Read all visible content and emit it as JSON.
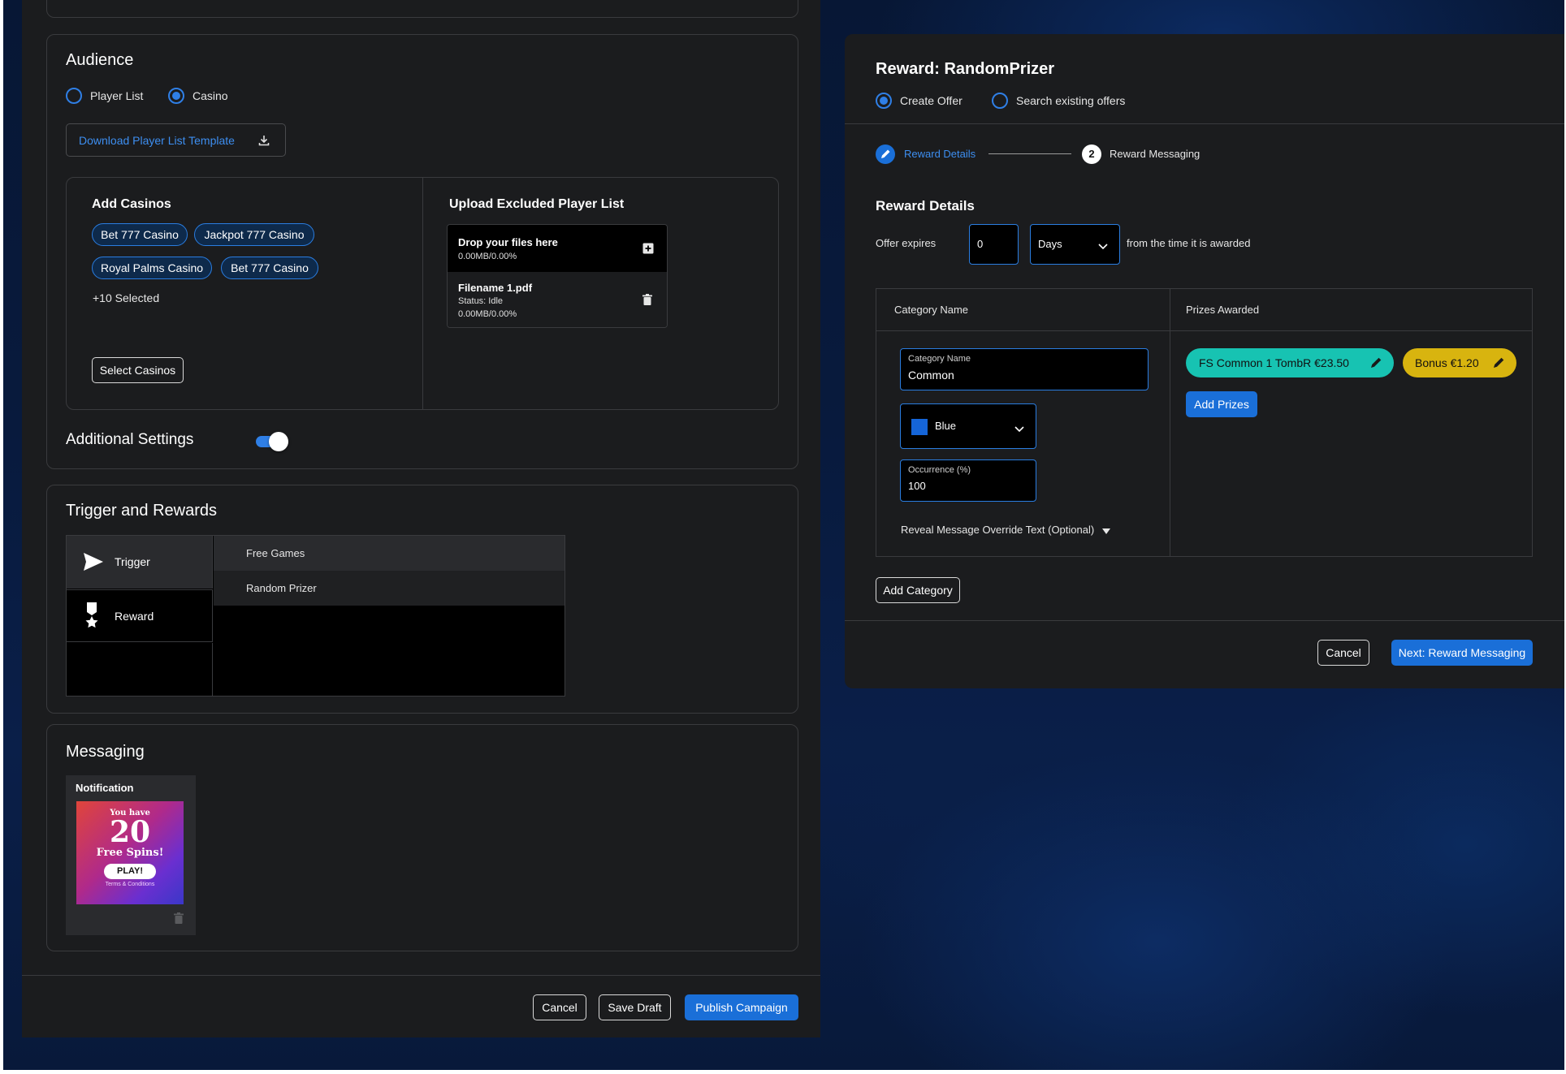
{
  "audience": {
    "title": "Audience",
    "radio_player_list": "Player List",
    "radio_casino": "Casino",
    "download_template": "Download Player List Template",
    "add_casinos_title": "Add Casinos",
    "casinos": [
      "Bet 777 Casino",
      "Jackpot 777 Casino",
      "Royal Palms Casino",
      "Bet 777 Casino"
    ],
    "more_selected": "+10 Selected",
    "select_casinos_button": "Select Casinos",
    "upload_title": "Upload Excluded Player List",
    "drop_title": "Drop your files here",
    "drop_progress": "0.00MB/0.00%",
    "file_name": "Filename 1.pdf",
    "file_status": "Status: Idle",
    "file_progress": "0.00MB/0.00%",
    "additional_settings": "Additional Settings",
    "additional_settings_enabled": true
  },
  "trigger_rewards": {
    "title": "Trigger and Rewards",
    "menu": [
      "Trigger",
      "Reward"
    ],
    "options": [
      "Free Games",
      "Random Prizer"
    ]
  },
  "messaging": {
    "title": "Messaging",
    "notification_label": "Notification",
    "promo_line1": "You have",
    "promo_number": "20",
    "promo_line2": "Free Spins!",
    "promo_button": "PLAY!",
    "promo_terms": "Terms & Conditions"
  },
  "footer": {
    "cancel": "Cancel",
    "save_draft": "Save Draft",
    "publish": "Publish Campaign"
  },
  "modal": {
    "title": "Reward: RandomPrizer",
    "radio_create": "Create Offer",
    "radio_search": "Search existing offers",
    "step1": "Reward Details",
    "step2_number": "2",
    "step2": "Reward Messaging",
    "section_title": "Reward Details",
    "offer_expires_label": "Offer expires",
    "offer_expires_value": "0",
    "offer_expires_unit": "Days",
    "offer_expires_suffix": "from the time it is awarded",
    "table_header_category": "Category Name",
    "table_header_prizes": "Prizes Awarded",
    "category_field_label": "Category Name",
    "category_field_value": "Common",
    "color_value": "Blue",
    "occurrence_label": "Occurrence (%)",
    "occurrence_value": "100",
    "reveal_override": "Reveal Message Override Text (Optional)",
    "prizes": [
      "FS Common 1 TombR €23.50",
      "Bonus €1.20"
    ],
    "add_prizes": "Add Prizes",
    "add_category": "Add Category",
    "cancel": "Cancel",
    "next": "Next: Reward Messaging"
  },
  "colors": {
    "accent": "#1a6fd8",
    "panel": "#1b1c1e",
    "prize_teal": "#17c3b2",
    "prize_yellow": "#d8b40f",
    "swatch_blue": "#1565d8"
  }
}
